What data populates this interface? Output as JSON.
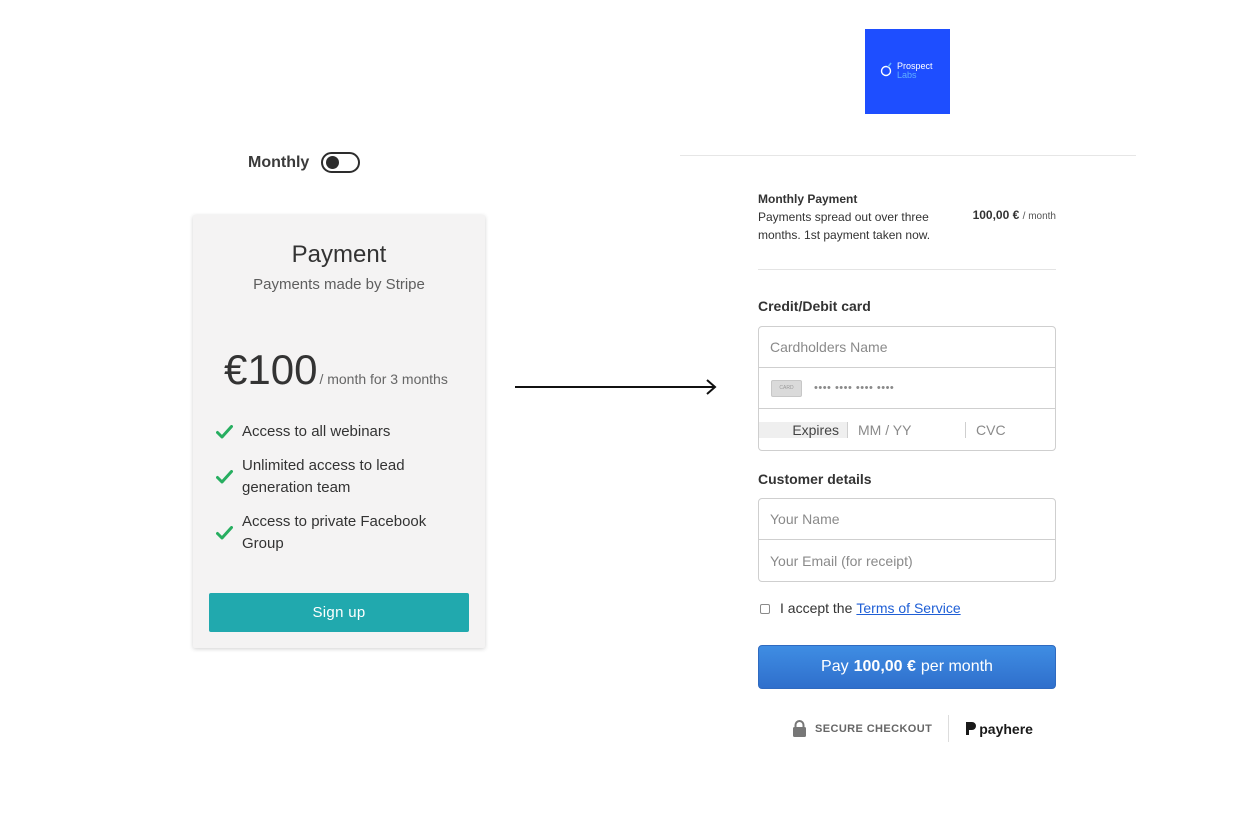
{
  "plan_toggle": {
    "label": "Monthly",
    "state": "off"
  },
  "pricing_card": {
    "title": "Payment",
    "subtitle": "Payments made by Stripe",
    "price": "€100",
    "period": "/ month for 3 months",
    "features": [
      "Access to all webinars",
      "Unlimited access to lead generation team",
      "Access to private Facebook Group"
    ],
    "signup_label": "Sign up"
  },
  "logo": {
    "line1": "Prospect",
    "line2": "Labs"
  },
  "checkout": {
    "summary": {
      "title": "Monthly Payment",
      "description": "Payments spread out over three months. 1st payment taken now.",
      "amount": "100,00 €",
      "per": "/ month"
    },
    "card_section_label": "Credit/Debit card",
    "cardholder_placeholder": "Cardholders Name",
    "card_icon_text": "CARD",
    "card_number_placeholder": "•••• •••• •••• ••••",
    "expires_label": "Expires",
    "expiry_placeholder": "MM / YY",
    "cvc_placeholder": "CVC",
    "customer_section_label": "Customer details",
    "name_placeholder": "Your Name",
    "email_placeholder": "Your Email (for receipt)",
    "terms_text": "I accept the",
    "terms_link": "Terms of Service",
    "pay_prefix": "Pay",
    "pay_amount": "100,00 €",
    "pay_suffix": "per month",
    "secure_label": "SECURE CHECKOUT",
    "payhere_label": "payhere"
  },
  "colors": {
    "signup_button": "#21a9ae",
    "check": "#27ae60",
    "pay_button": "#3278d6",
    "logo_bg": "#1e4eff",
    "link": "#1f5fd6"
  }
}
